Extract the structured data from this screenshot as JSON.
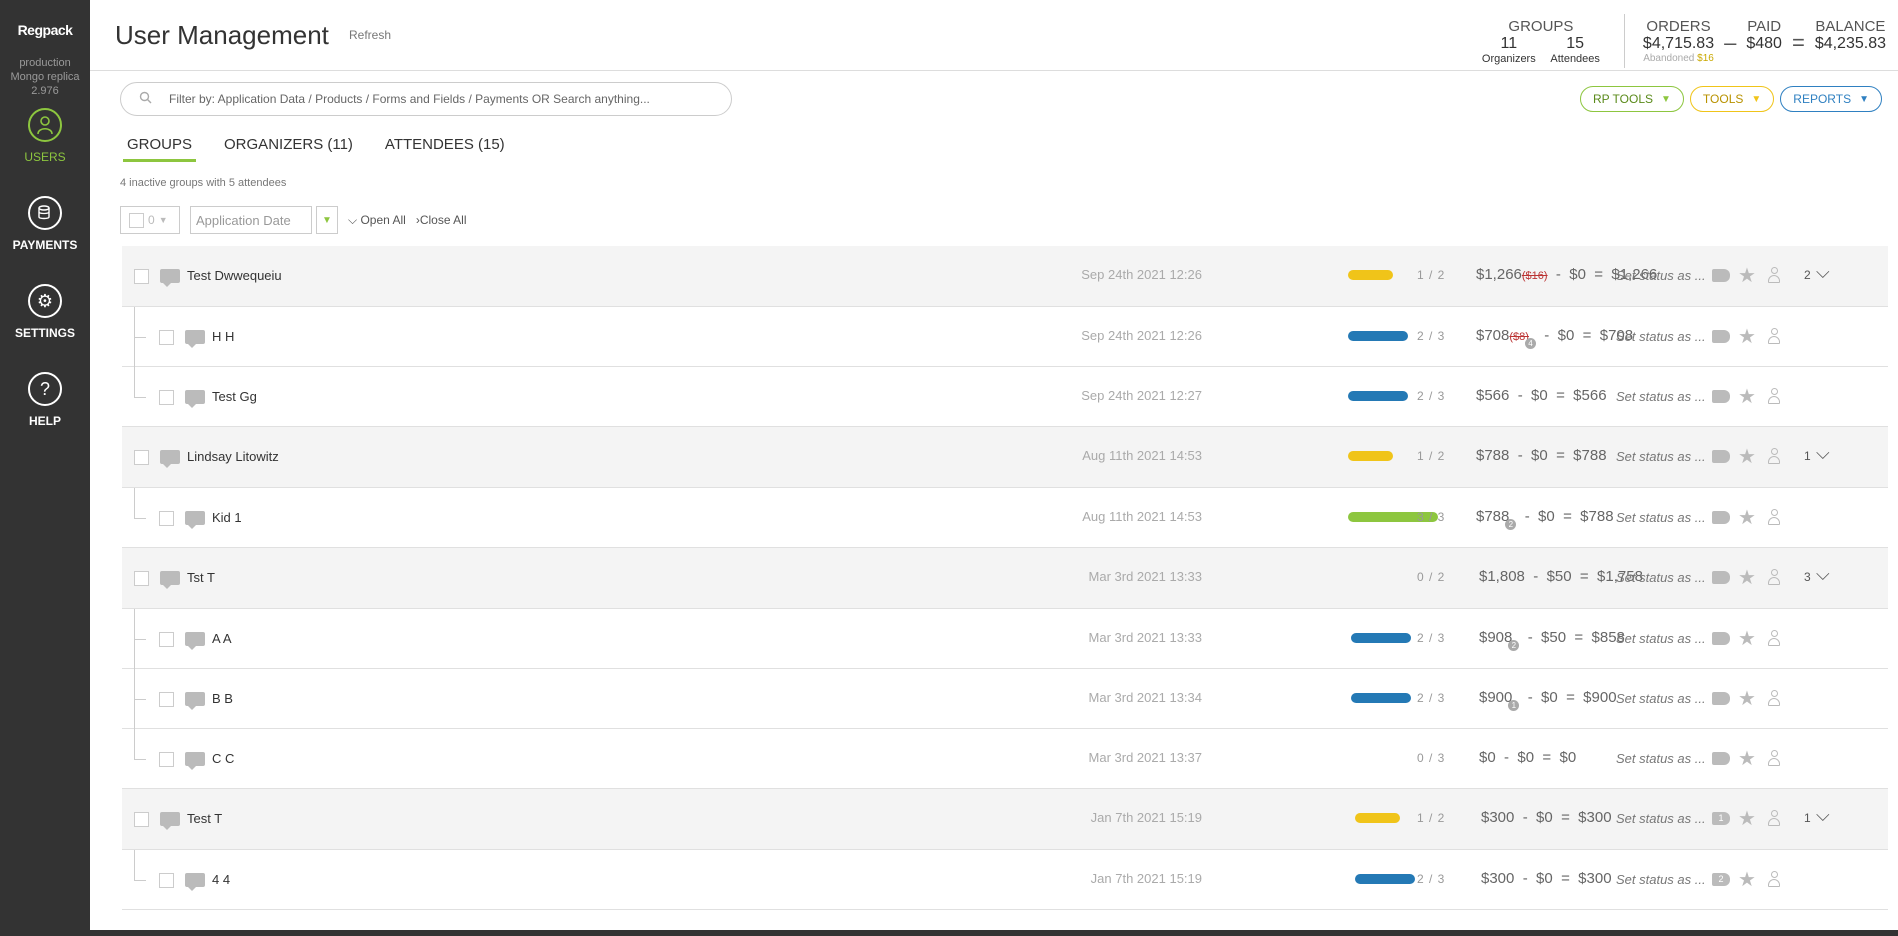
{
  "sidebar": {
    "logo": "Regpack",
    "env": [
      "production",
      "Mongo replica",
      "2.976"
    ],
    "items": [
      {
        "label": "USERS",
        "icon": "user-icon",
        "active": true
      },
      {
        "label": "PAYMENTS",
        "icon": "payments-icon",
        "active": false
      },
      {
        "label": "SETTINGS",
        "icon": "gear-icon",
        "active": false
      },
      {
        "label": "HELP",
        "icon": "help-icon",
        "active": false
      }
    ]
  },
  "header": {
    "title": "User Management",
    "refresh": "Refresh",
    "groups_label": "GROUPS",
    "organizers_count": "11",
    "organizers_label": "Organizers",
    "attendees_count": "15",
    "attendees_label": "Attendees",
    "orders_label": "ORDERS",
    "orders_value": "$4,715.83",
    "abandoned_label": "Abandoned",
    "abandoned_value": "$16",
    "paid_label": "PAID",
    "paid_value": "$480",
    "balance_label": "BALANCE",
    "balance_value": "$4,235.83",
    "minus": "–",
    "equals": "="
  },
  "search": {
    "placeholder": "Filter by: Application Data / Products / Forms and Fields / Payments OR Search anything..."
  },
  "tools": {
    "rp_tools": "RP TOOLS",
    "tools": "TOOLS",
    "reports": "REPORTS"
  },
  "tabs": [
    {
      "label": "GROUPS",
      "active": true
    },
    {
      "label": "ORGANIZERS (11)",
      "active": false
    },
    {
      "label": "ATTENDEES (15)",
      "active": false
    }
  ],
  "inactive_note": "4 inactive groups with 5 attendees",
  "filters": {
    "selected_count": "0",
    "date_field": "Application Date",
    "open_all": "Open All",
    "close_all": "Close All"
  },
  "colors": {
    "green": "#8dc63f",
    "yellow": "#f0c419",
    "blue": "#2479b5",
    "sidebar": "#333333"
  },
  "rows": [
    {
      "type": "group",
      "name": "Test Dwwequeiu",
      "date": "Sep 24th 2021 12:26",
      "bar": "yellow",
      "progress": 0.5,
      "frac": "1 / 2",
      "orders": "$1,266",
      "strike": "($16)",
      "paid": "$0",
      "balance": "$1,266",
      "status": "Set status as ...",
      "count": "2"
    },
    {
      "type": "member",
      "name": "H H",
      "date": "Sep 24th 2021 12:26",
      "bar": "blue",
      "progress": 0.67,
      "frac": "2 / 3",
      "orders": "$708",
      "strike": "($8)",
      "badge": "4",
      "paid": "$0",
      "balance": "$708",
      "status": "Set status as ..."
    },
    {
      "type": "member",
      "name": "Test Gg",
      "date": "Sep 24th 2021 12:27",
      "bar": "blue",
      "progress": 0.67,
      "frac": "2 / 3",
      "orders": "$566",
      "paid": "$0",
      "balance": "$566",
      "status": "Set status as ..."
    },
    {
      "type": "group",
      "name": "Lindsay Litowitz",
      "date": "Aug 11th 2021 14:53",
      "bar": "yellow",
      "progress": 0.5,
      "frac": "1 / 2",
      "orders": "$788",
      "paid": "$0",
      "balance": "$788",
      "status": "Set status as ...",
      "count": "1"
    },
    {
      "type": "member",
      "name": "Kid 1",
      "date": "Aug 11th 2021 14:53",
      "bar": "green",
      "progress": 1,
      "frac": "3 / 3",
      "orders": "$788",
      "badge": "2",
      "paid": "$0",
      "balance": "$788",
      "status": "Set status as ..."
    },
    {
      "type": "group",
      "name": "Tst T",
      "date": "Mar 3rd 2021 13:33",
      "bar": "",
      "progress": 0,
      "frac": "0 / 2",
      "orders": "$1,808",
      "paid": "$50",
      "balance": "$1,758",
      "status": "Set status as ...",
      "count": "3"
    },
    {
      "type": "member",
      "name": "A A",
      "date": "Mar 3rd 2021 13:33",
      "bar": "blue",
      "progress": 0.67,
      "frac": "2 / 3",
      "orders": "$908",
      "badge": "2",
      "paid": "$50",
      "balance": "$858",
      "status": "Set status as ..."
    },
    {
      "type": "member",
      "name": "B B",
      "date": "Mar 3rd 2021 13:34",
      "bar": "blue",
      "progress": 0.67,
      "frac": "2 / 3",
      "orders": "$900",
      "badge": "1",
      "paid": "$0",
      "balance": "$900",
      "status": "Set status as ..."
    },
    {
      "type": "member",
      "name": "C C",
      "date": "Mar 3rd 2021 13:37",
      "bar": "",
      "progress": 0,
      "frac": "0 / 3",
      "orders": "$0",
      "paid": "$0",
      "balance": "$0",
      "status": "Set status as ..."
    },
    {
      "type": "group",
      "name": "Test T",
      "date": "Jan 7th 2021 15:19",
      "bar": "yellow",
      "progress": 0.5,
      "frac": "1 / 2",
      "orders": "$300",
      "paid": "$0",
      "balance": "$300",
      "status": "Set status as ...",
      "tag": "1",
      "count": "1"
    },
    {
      "type": "member",
      "name": "4 4",
      "date": "Jan 7th 2021 15:19",
      "bar": "blue",
      "progress": 0.67,
      "frac": "2 / 3",
      "orders": "$300",
      "paid": "$0",
      "balance": "$300",
      "status": "Set status as ...",
      "tag": "2"
    }
  ]
}
